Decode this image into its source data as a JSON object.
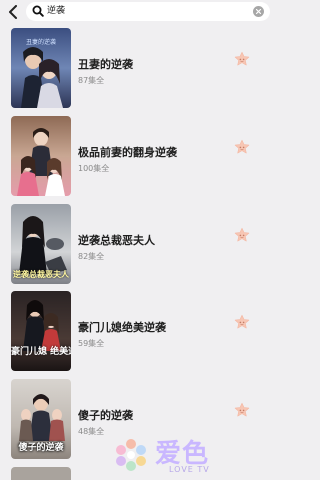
{
  "search": {
    "query": "逆袭"
  },
  "items": [
    {
      "title": "丑妻的逆袭",
      "episodes": "87集全",
      "poster_caption": "",
      "poster_theme": "blue"
    },
    {
      "title": "极品前妻的翻身逆袭",
      "episodes": "100集全",
      "poster_caption": "",
      "poster_theme": "pink"
    },
    {
      "title": "逆袭总裁恶夫人",
      "episodes": "82集全",
      "poster_caption": "逆袭总裁恶夫人",
      "poster_theme": "gray"
    },
    {
      "title": "豪门儿媳绝美逆袭",
      "episodes": "59集全",
      "poster_caption": "豪门儿媳 绝美逆袭",
      "poster_theme": "dark"
    },
    {
      "title": "傻子的逆袭",
      "episodes": "48集全",
      "poster_caption": "傻子的逆袭",
      "poster_theme": "light"
    }
  ],
  "watermark": {
    "name": "爱色",
    "sub": "LOVE TV"
  },
  "colors": {
    "accent": "#f2a14a",
    "background": "#f0eff1",
    "star": "#f7c6b4"
  }
}
